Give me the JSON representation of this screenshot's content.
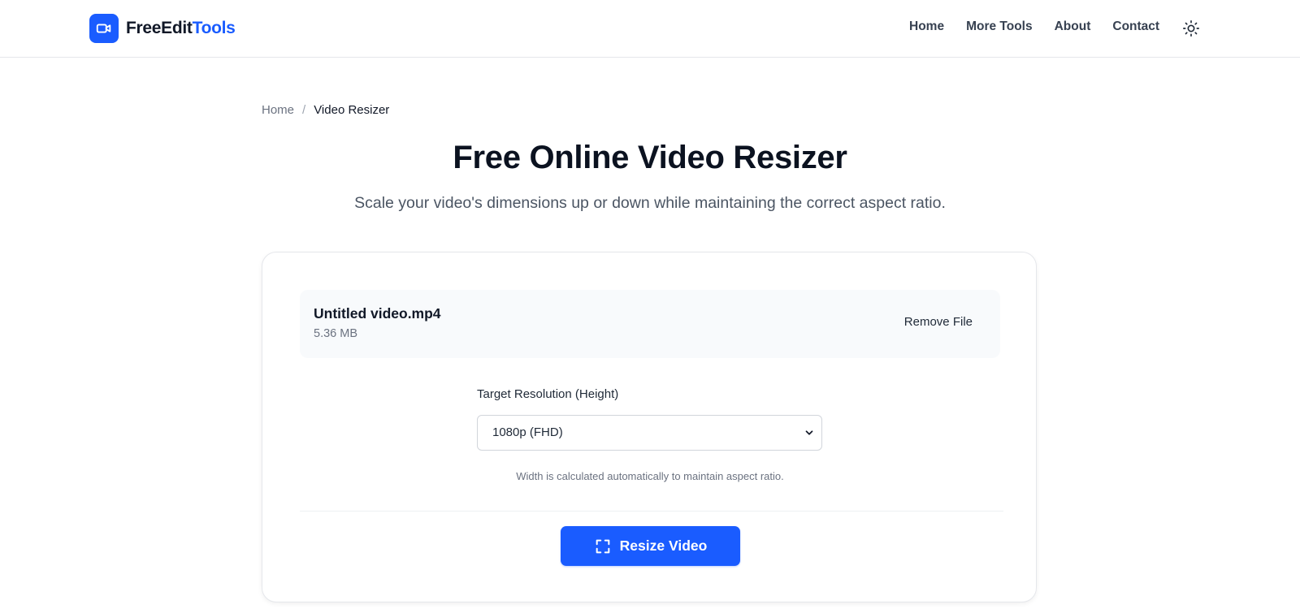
{
  "header": {
    "brand": {
      "part1": "FreeEdit",
      "part2": "Tools",
      "icon": "video-camera-icon"
    },
    "nav": [
      "Home",
      "More Tools",
      "About",
      "Contact"
    ],
    "theme_icon": "sun-icon"
  },
  "breadcrumb": {
    "home": "Home",
    "separator": "/",
    "current": "Video Resizer"
  },
  "hero": {
    "title": "Free Online Video Resizer",
    "subtitle": "Scale your video's dimensions up or down while maintaining the correct aspect ratio."
  },
  "file": {
    "name": "Untitled video.mp4",
    "size": "5.36 MB",
    "remove_label": "Remove File"
  },
  "resolution": {
    "label": "Target Resolution (Height)",
    "selected": "1080p (FHD)",
    "hint": "Width is calculated automatically to maintain aspect ratio."
  },
  "action": {
    "label": "Resize Video",
    "icon": "expand-icon"
  },
  "colors": {
    "accent": "#1a5cff",
    "text": "#111827",
    "muted": "#6b7280"
  }
}
